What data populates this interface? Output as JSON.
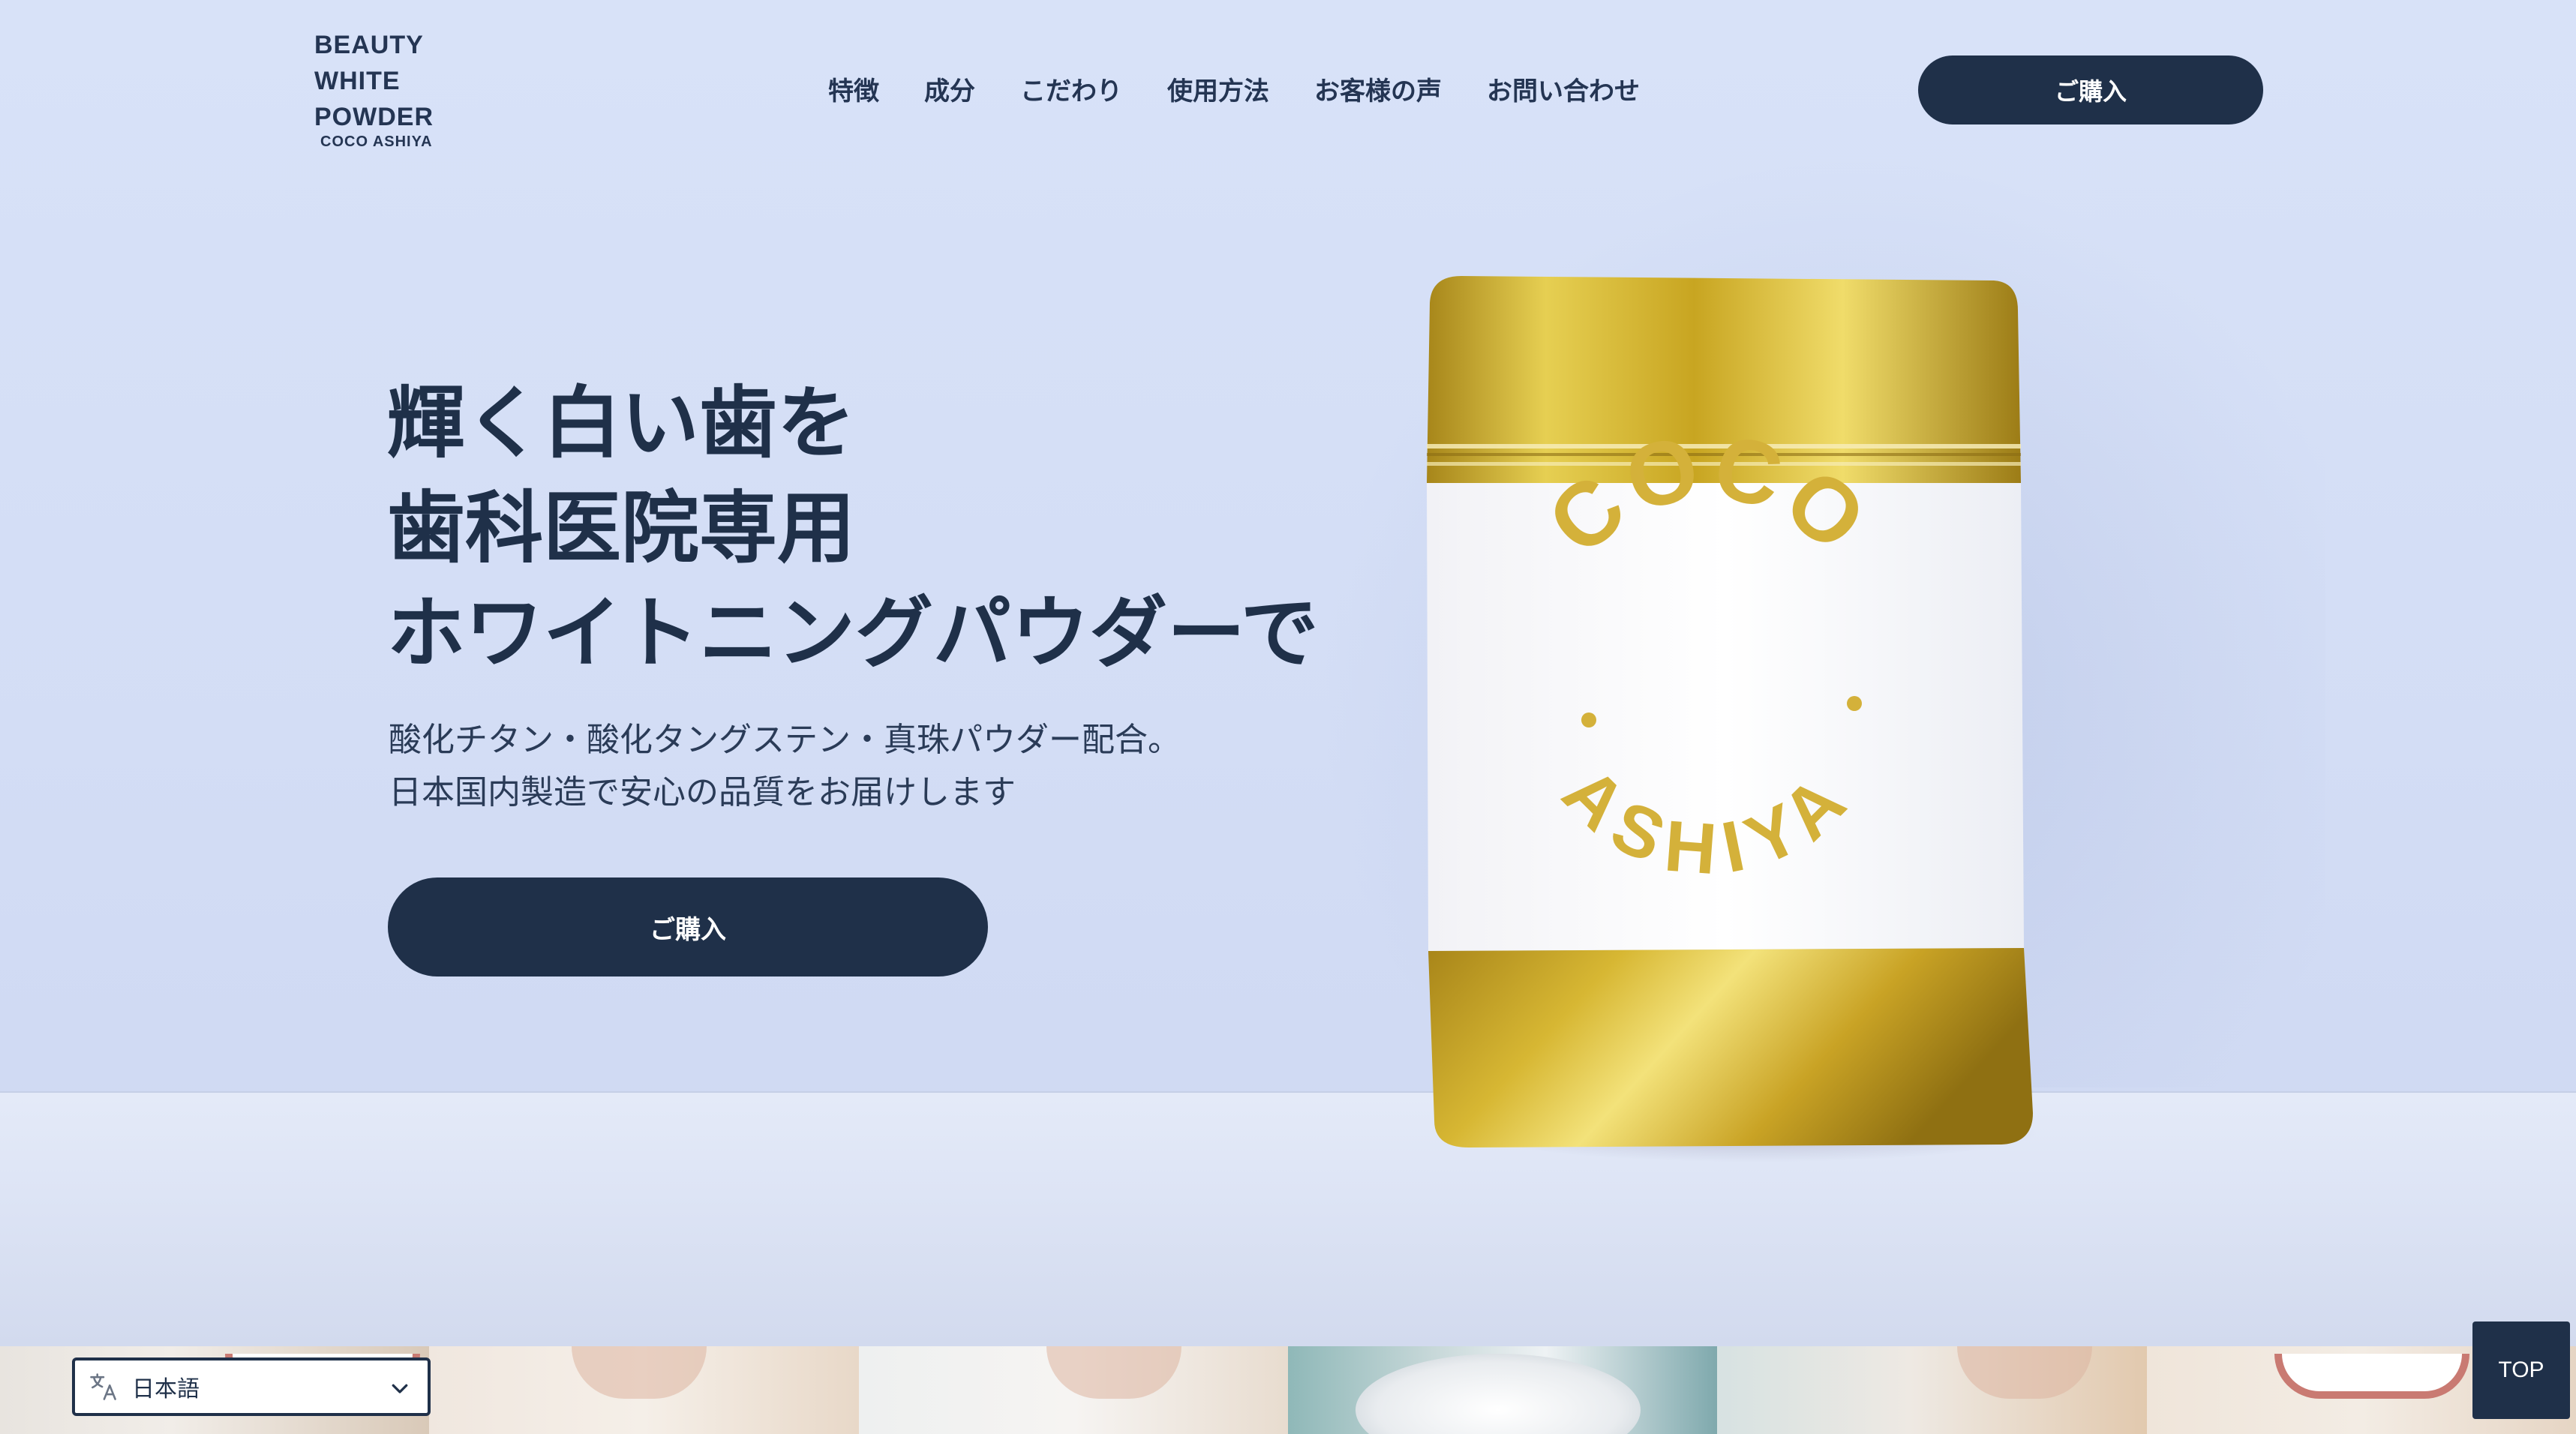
{
  "brand": {
    "logo_lines": [
      "BEAUTY",
      "WHITE",
      "POWDER"
    ],
    "logo_sub": "COCO ASHIYA"
  },
  "nav": {
    "items": [
      {
        "label": "特徴"
      },
      {
        "label": "成分"
      },
      {
        "label": "こだわり"
      },
      {
        "label": "使用方法"
      },
      {
        "label": "お客様の声"
      },
      {
        "label": "お問い合わせ"
      }
    ]
  },
  "header": {
    "buy_label": "ご購入"
  },
  "hero": {
    "headline": [
      "輝く白い歯を",
      "歯科医院専用",
      "ホワイトニングパウダーで"
    ],
    "subcopy": [
      "酸化チタン・酸化タングステン・真珠パウダー配合。",
      "日本国内製造で安心の品質をお届けします"
    ],
    "buy_label": "ご購入"
  },
  "product": {
    "label_top": "COCO",
    "label_bottom": "ASHIYA"
  },
  "language": {
    "selected": "日本語"
  },
  "top_button": {
    "label": "TOP"
  },
  "colors": {
    "navy": "#1f3049",
    "background": "#d6e0f6",
    "gold": "#c9a227"
  }
}
